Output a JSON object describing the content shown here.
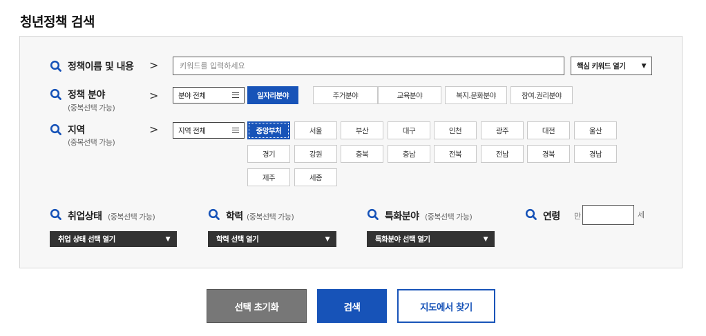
{
  "page_title": "청년정책 검색",
  "icons": {
    "search": "search-icon",
    "arrow": "chevron-right-icon"
  },
  "colors": {
    "accent": "#1753b8",
    "dark_select": "#333333",
    "reset_button": "#777777"
  },
  "keyword": {
    "label": "정책이름 및 내용",
    "arrow": ">",
    "placeholder": "키워드를 입력하세요",
    "core_keyword_label": "핵심 키워드 열기",
    "caret": "▼"
  },
  "field": {
    "label": "정책 분야",
    "sub": "(중복선택 가능)",
    "arrow": ">",
    "all_label": "분야 전체",
    "chips": [
      "일자리분야",
      "주거분야",
      "교육분야",
      "복지.문화분야",
      "참여.권리분야"
    ],
    "selected": "일자리분야"
  },
  "region": {
    "label": "지역",
    "sub": "(중복선택 가능)",
    "arrow": ">",
    "all_label": "지역 전체",
    "chips": [
      "중앙부처",
      "서울",
      "부산",
      "대구",
      "인천",
      "광주",
      "대전",
      "울산",
      "경기",
      "강원",
      "충북",
      "충남",
      "전북",
      "전남",
      "경북",
      "경남",
      "제주",
      "세종"
    ],
    "selected": "중앙부처"
  },
  "employment": {
    "label": "취업상태",
    "sub": "(중복선택 가능)",
    "select_label": "취업 상태 선택 열기",
    "caret": "▼"
  },
  "education": {
    "label": "학력",
    "sub": "(중복선택 가능)",
    "select_label": "학력 선택 열기",
    "caret": "▼"
  },
  "specialty": {
    "label": "특화분야",
    "sub": "(중복선택 가능)",
    "select_label": "특화분야 선택 열기",
    "caret": "▼"
  },
  "age": {
    "label": "연령",
    "prefix": "만",
    "suffix": "세",
    "value": ""
  },
  "buttons": {
    "reset": "선택 초기화",
    "search": "검색",
    "map": "지도에서 찾기"
  }
}
